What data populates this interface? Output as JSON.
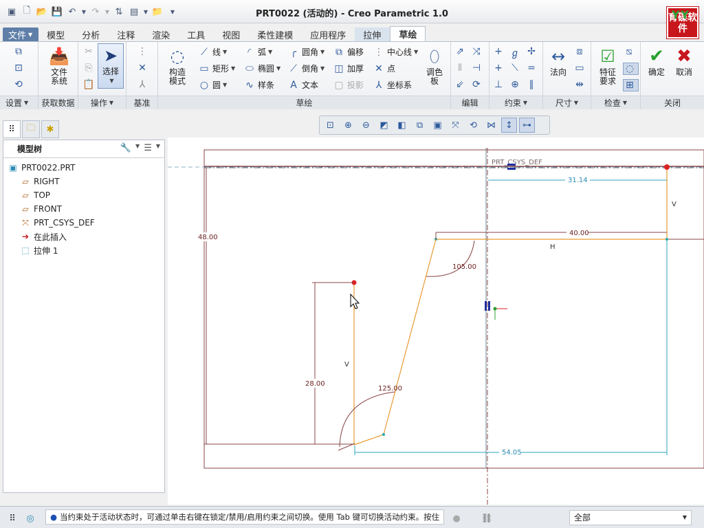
{
  "window": {
    "title": "PRT0022 (活动的) - Creo Parametric 1.0",
    "brand_top": "YY",
    "brand_text": "育碟软件"
  },
  "tabs": [
    "文件",
    "模型",
    "分析",
    "注释",
    "渲染",
    "工具",
    "视图",
    "柔性建模",
    "应用程序",
    "拉伸",
    "草绘"
  ],
  "ribbon": {
    "groups": {
      "setup": "设置",
      "get_data": "获取数据",
      "operations": "操作",
      "datum": "基准",
      "sketch": "草绘",
      "edit": "编辑",
      "constrain": "约束",
      "dimension": "尺寸",
      "inspect": "检查",
      "close": "关闭"
    },
    "file_system": "文件系统",
    "select": "选择",
    "construction_mode": "构造模式",
    "line": "线",
    "rectangle": "矩形",
    "circle": "圆",
    "arc": "弧",
    "ellipse": "椭圆",
    "spline": "样条",
    "fillet": "圆角",
    "chamfer": "倒角",
    "text": "文本",
    "offset": "偏移",
    "thicken": "加厚",
    "project": "投影",
    "centerline": "中心线",
    "point": "点",
    "coord_sys": "坐标系",
    "palette": "调色板",
    "normal": "法向",
    "feature_req": "特征要求",
    "ok": "确定",
    "cancel": "取消"
  },
  "model_tree": {
    "title": "模型树",
    "items": [
      "PRT0022.PRT",
      "RIGHT",
      "TOP",
      "FRONT",
      "PRT_CSYS_DEF",
      "在此插入",
      "拉伸 1"
    ]
  },
  "sketch": {
    "csys_label": "PRT_CSYS_DEF",
    "dims": {
      "d_31_14": "31.14",
      "d_48": "48.00",
      "d_40": "40.00",
      "d_105": "105.00",
      "d_28": "28.00",
      "d_125": "125.00",
      "d_54_05": "54.05"
    },
    "constraint_v": "V",
    "constraint_h": "H"
  },
  "status": {
    "message": "当约束处于活动状态时，可通过单击右键在锁定/禁用/启用约束之间切换。使用 Tab 键可切换活动约束。按住",
    "filter_value": "全部"
  }
}
